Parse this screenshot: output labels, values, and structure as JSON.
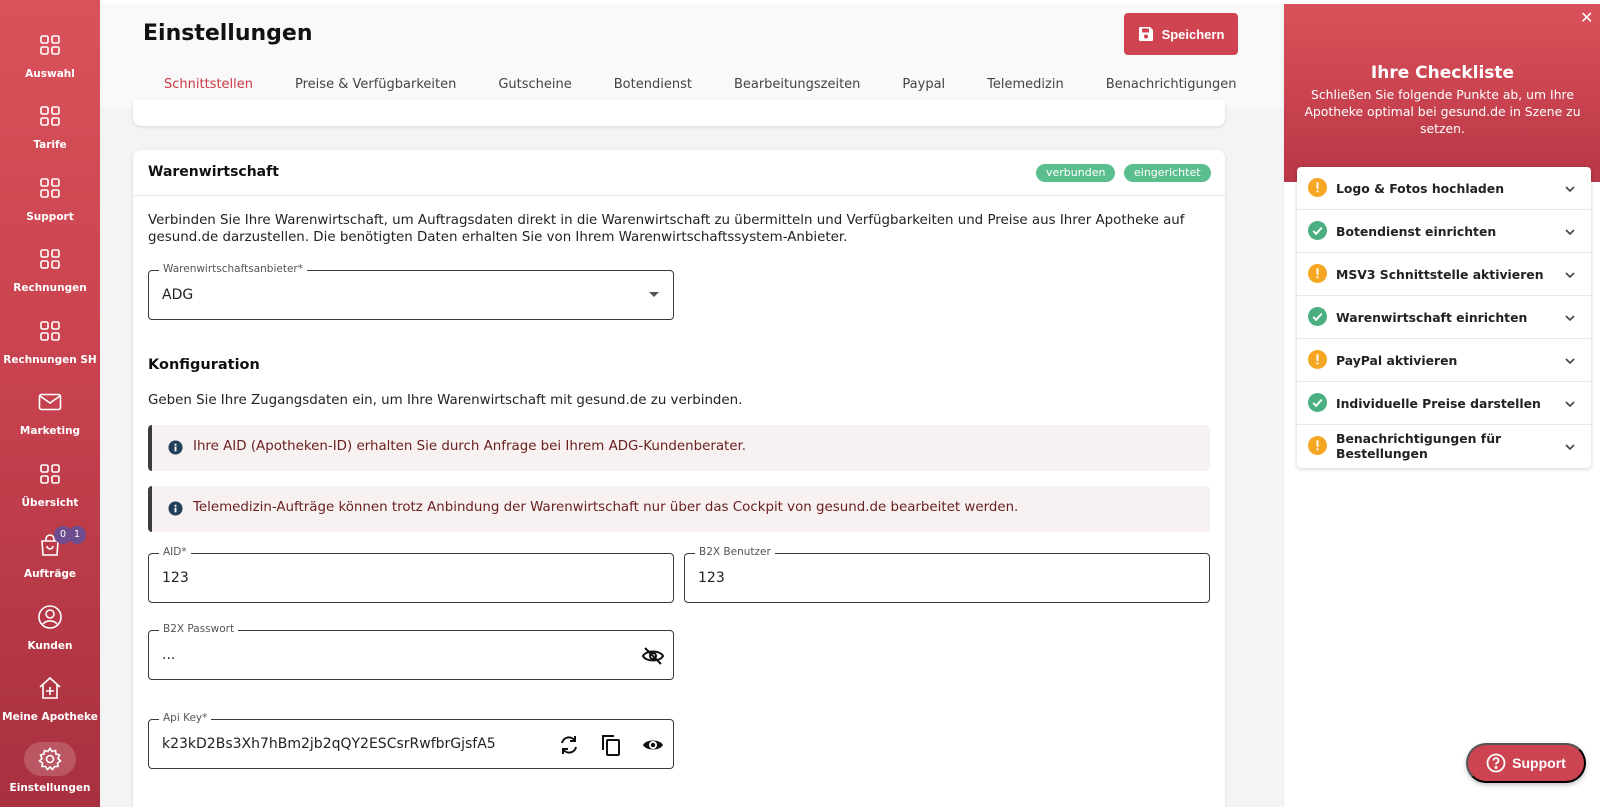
{
  "sidebar": {
    "items": [
      {
        "label": "Auswahl",
        "icon": "grid-icon"
      },
      {
        "label": "Tarife",
        "icon": "grid-icon"
      },
      {
        "label": "Support",
        "icon": "grid-icon"
      },
      {
        "label": "Rechnungen",
        "icon": "grid-icon"
      },
      {
        "label": "Rechnungen SH",
        "icon": "grid-icon"
      },
      {
        "label": "Marketing",
        "icon": "mail-icon"
      },
      {
        "label": "Übersicht",
        "icon": "grid-icon"
      },
      {
        "label": "Aufträge",
        "icon": "shopping-bag-icon",
        "badges": [
          "0",
          "1"
        ]
      },
      {
        "label": "Kunden",
        "icon": "user-circle-icon"
      },
      {
        "label": "Meine Apotheke",
        "icon": "home-plus-icon"
      },
      {
        "label": "Einstellungen",
        "icon": "gear-icon",
        "active": true
      }
    ]
  },
  "header": {
    "title": "Einstellungen",
    "save_label": "Speichern"
  },
  "tabs": [
    {
      "label": "Schnittstellen",
      "active": true
    },
    {
      "label": "Preise & Verfügbarkeiten"
    },
    {
      "label": "Gutscheine"
    },
    {
      "label": "Botendienst"
    },
    {
      "label": "Bearbeitungszeiten"
    },
    {
      "label": "Paypal"
    },
    {
      "label": "Telemedizin"
    },
    {
      "label": "Benachrichtigungen"
    }
  ],
  "warenwirtschaft": {
    "title": "Warenwirtschaft",
    "status_chips": [
      "verbunden",
      "eingerichtet"
    ],
    "description": "Verbinden Sie Ihre Warenwirtschaft, um Auftragsdaten direkt in die Warenwirtschaft zu übermitteln und Verfügbarkeiten und Preise aus Ihrer Apotheke auf gesund.de darzustellen. Die benötigten Daten erhalten Sie von Ihrem Warenwirtschaftssystem-Anbieter.",
    "provider_label": "Warenwirtschaftsanbieter*",
    "provider_value": "ADG",
    "config_title": "Konfiguration",
    "config_description": "Geben Sie Ihre Zugangsdaten ein, um Ihre Warenwirtschaft mit gesund.de zu verbinden.",
    "alerts": [
      "Ihre AID (Apotheken-ID) erhalten Sie durch Anfrage bei Ihrem ADG-Kundenberater.",
      "Telemedizin-Aufträge können trotz Anbindung der Warenwirtschaft nur über das Cockpit von gesund.de bearbeitet werden."
    ],
    "fields": {
      "aid_label": "AID*",
      "aid_value": "123",
      "b2x_user_label": "B2X Benutzer",
      "b2x_user_value": "123",
      "b2x_password_label": "B2X Passwort",
      "b2x_password_value": "...",
      "api_key_label": "Api Key*",
      "api_key_value": "k23kD2Bs3Xh7hBm2jb2qQY2ESCsrRwfbrGjsfA5"
    }
  },
  "checklist": {
    "title": "Ihre Checkliste",
    "subtitle": "Schließen Sie folgende Punkte ab, um Ihre Apotheke optimal bei gesund.de in Szene zu setzen.",
    "items": [
      {
        "label": "Logo & Fotos hochladen",
        "status": "warning"
      },
      {
        "label": "Botendienst einrichten",
        "status": "done"
      },
      {
        "label": "MSV3 Schnittstelle aktivieren",
        "status": "warning"
      },
      {
        "label": "Warenwirtschaft einrichten",
        "status": "done"
      },
      {
        "label": "PayPal aktivieren",
        "status": "warning"
      },
      {
        "label": "Individuelle Preise darstellen",
        "status": "done"
      },
      {
        "label": "Benachrichtigungen für Bestellungen",
        "status": "warning"
      }
    ]
  },
  "support_button": "Support",
  "colors": {
    "brand": "#cf4450",
    "success": "#4caf82",
    "warning": "#f5a623"
  }
}
